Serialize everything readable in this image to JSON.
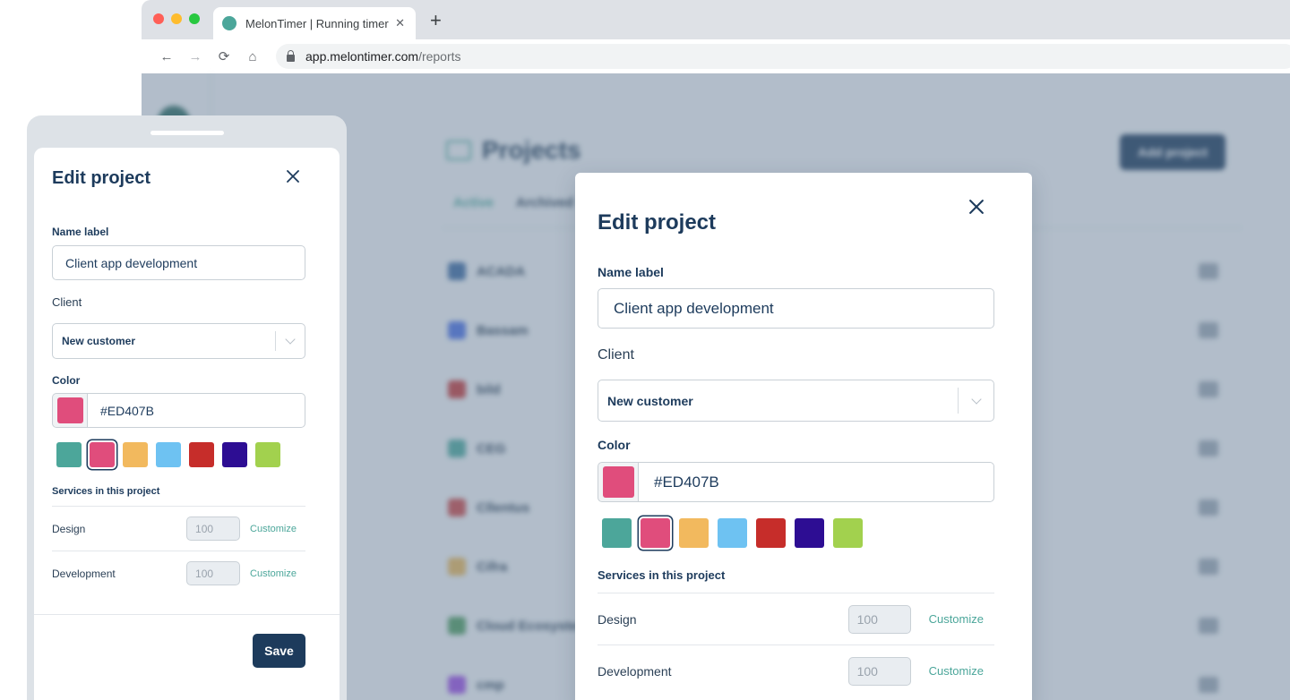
{
  "browser": {
    "tab_title": "MelonTimer | Running timer",
    "tab_close": "✕",
    "new_tab": "+",
    "url_host": "app.melontimer.com",
    "url_path": "/reports",
    "nav": {
      "back": "←",
      "forward": "→",
      "reload": "⟳",
      "home": "⌂"
    }
  },
  "background_app": {
    "page_title": "Projects",
    "add_project_label": "Add project",
    "tabs": [
      "Active",
      "Archived"
    ],
    "projects": [
      {
        "name": "ACADA",
        "color": "#3d6aa0"
      },
      {
        "name": "Bassam",
        "color": "#4a6fe0"
      },
      {
        "name": "bild",
        "color": "#c23a3a"
      },
      {
        "name": "CEG",
        "color": "#4ba69a"
      },
      {
        "name": "Cllentus",
        "color": "#c84848"
      },
      {
        "name": "Cifra",
        "color": "#e4b45a"
      },
      {
        "name": "Cloud Ecosystem",
        "color": "#4f9a60"
      },
      {
        "name": "cmp",
        "color": "#9a4de0"
      }
    ]
  },
  "form": {
    "title": "Edit project",
    "close_icon": "✕",
    "name_label": "Name label",
    "name_value": "Client app development",
    "client_label": "Client",
    "client_value": "New customer",
    "color_label": "Color",
    "color_hex": "#ED407B",
    "selected_color": "#E04D7C",
    "palette": [
      "#4CA69A",
      "#E04D7C",
      "#F2B95E",
      "#6EC2F2",
      "#C62D2A",
      "#2D0D93",
      "#A2D14E"
    ],
    "selected_index": 1,
    "services_label": "Services in this project",
    "services": [
      {
        "name": "Design",
        "rate": "100",
        "action": "Customize"
      },
      {
        "name": "Development",
        "rate": "100",
        "action": "Customize"
      }
    ],
    "save_label": "Save"
  }
}
